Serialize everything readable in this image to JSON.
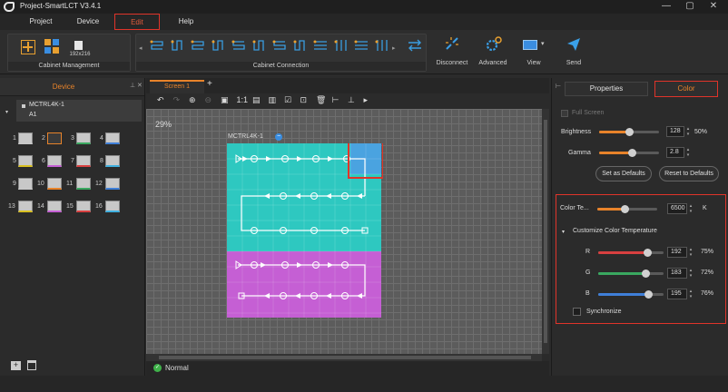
{
  "window": {
    "title": "Project-SmartLCT V3.4.1"
  },
  "menu": {
    "items": [
      "Project",
      "Device",
      "Edit",
      "Help"
    ]
  },
  "ribbon": {
    "cabinet_management": {
      "label": "Cabinet Management",
      "cabinet_size": "192x216"
    },
    "cabinet_connection": {
      "label": "Cabinet Connection"
    },
    "disconnect": "Disconnect",
    "advanced": "Advanced",
    "view": "View",
    "send": "Send"
  },
  "left_panel": {
    "title": "Device",
    "controller": "MCTRL4K-1",
    "output": "A1",
    "ports": [
      "1",
      "2",
      "3",
      "4",
      "5",
      "6",
      "7",
      "8",
      "9",
      "10",
      "11",
      "12",
      "13",
      "14",
      "15",
      "16"
    ]
  },
  "center": {
    "tab": "Screen 1",
    "add_tab": "+",
    "zoom": "29%",
    "screen_label": "MCTRL4K-1",
    "status": "Normal"
  },
  "right_panel": {
    "tabs": {
      "properties": "Properties",
      "color": "Color"
    },
    "full_screen": "Full Screen",
    "brightness": {
      "label": "Brightness",
      "value": "128",
      "percent": "50%",
      "level": 0.5
    },
    "gamma": {
      "label": "Gamma",
      "value": "2.8",
      "level": 0.55
    },
    "set_defaults": "Set as Defaults",
    "reset_defaults": "Reset to Defaults",
    "color_temp": {
      "label": "Color Te...",
      "value": "6500",
      "unit": "K",
      "level": 0.45
    },
    "customize": "Customize Color Temperature",
    "r": {
      "label": "R",
      "value": "192",
      "percent": "75%",
      "level": 0.75
    },
    "g": {
      "label": "G",
      "value": "183",
      "percent": "72%",
      "level": 0.72
    },
    "b": {
      "label": "B",
      "value": "195",
      "percent": "76%",
      "level": 0.76
    },
    "synchronize": "Synchronize"
  },
  "colors": {
    "accent": "#e8832a",
    "cyan": "#2ec8c0",
    "magenta": "#c55fd4",
    "selected": "#4aa3e0",
    "red_r": "#d84040",
    "green_g": "#3aa860",
    "blue_b": "#3f7fd8"
  }
}
